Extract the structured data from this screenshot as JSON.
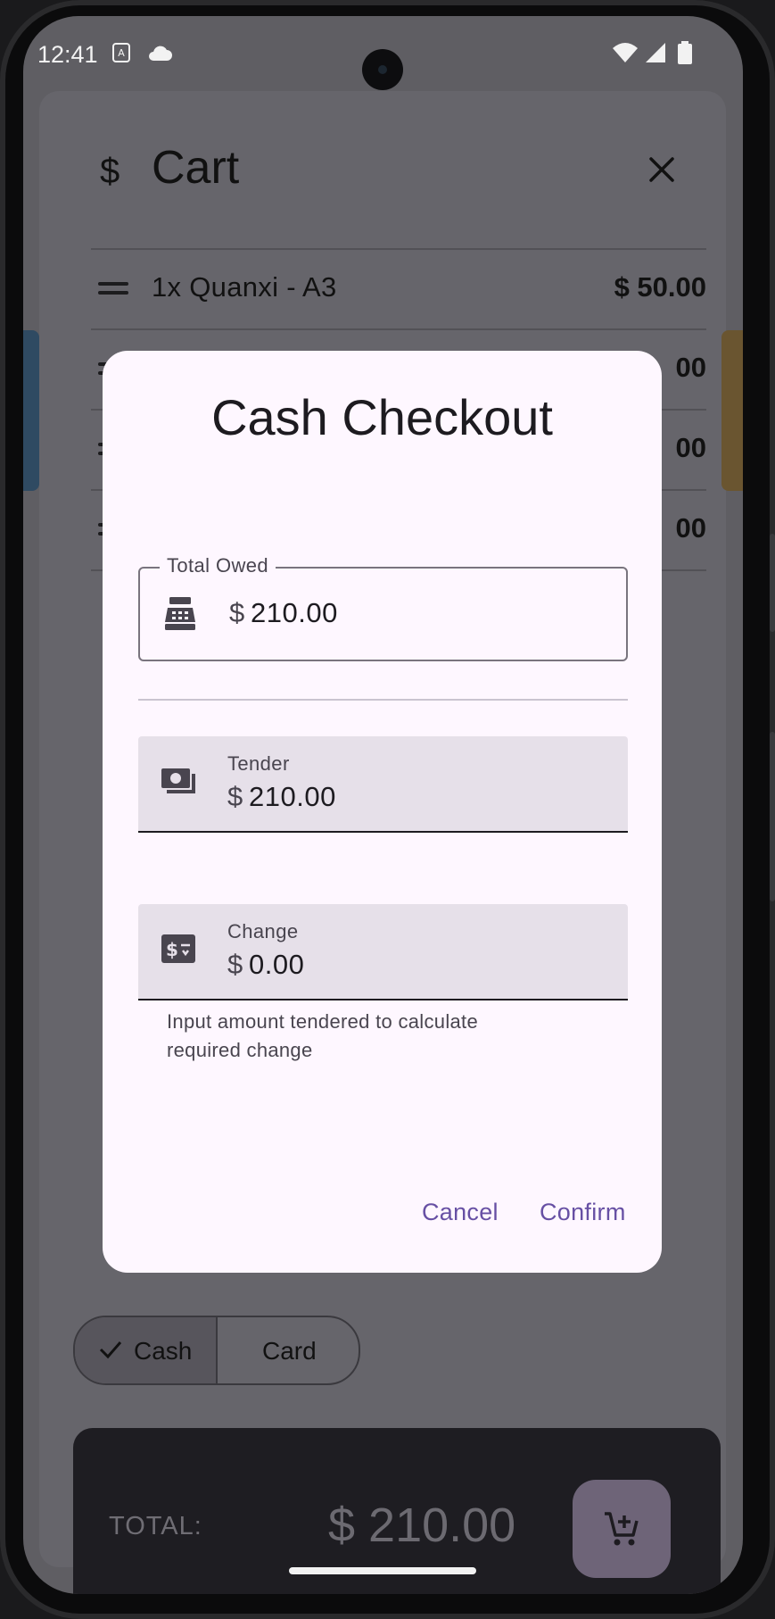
{
  "status_bar": {
    "time": "12:41"
  },
  "cart": {
    "title": "Cart",
    "currency_icon": "$",
    "items": [
      {
        "name": "1x Quanxi - A3",
        "price": "$ 50.00"
      },
      {
        "name": "",
        "price": "00"
      },
      {
        "name": "",
        "price": "00"
      },
      {
        "name": "",
        "price": "00"
      }
    ]
  },
  "payment_toggle": {
    "cash_label": "Cash",
    "card_label": "Card",
    "selected": "Cash"
  },
  "total_bar": {
    "label": "TOTAL:",
    "value": "$ 210.00"
  },
  "dialog": {
    "title": "Cash Checkout",
    "total_owed": {
      "label": "Total Owed",
      "prefix": "$",
      "value": "210.00"
    },
    "tender": {
      "label": "Tender",
      "prefix": "$",
      "value": "210.00"
    },
    "change": {
      "label": "Change",
      "prefix": "$",
      "value": "0.00",
      "supporting_text": "Input amount tendered to calculate required change"
    },
    "cancel_label": "Cancel",
    "confirm_label": "Confirm"
  },
  "colors": {
    "primary": "#6750a4",
    "dialog_surface": "#fef7ff",
    "filled_field": "#e6e0e9",
    "scrim": "#5f5e63"
  }
}
